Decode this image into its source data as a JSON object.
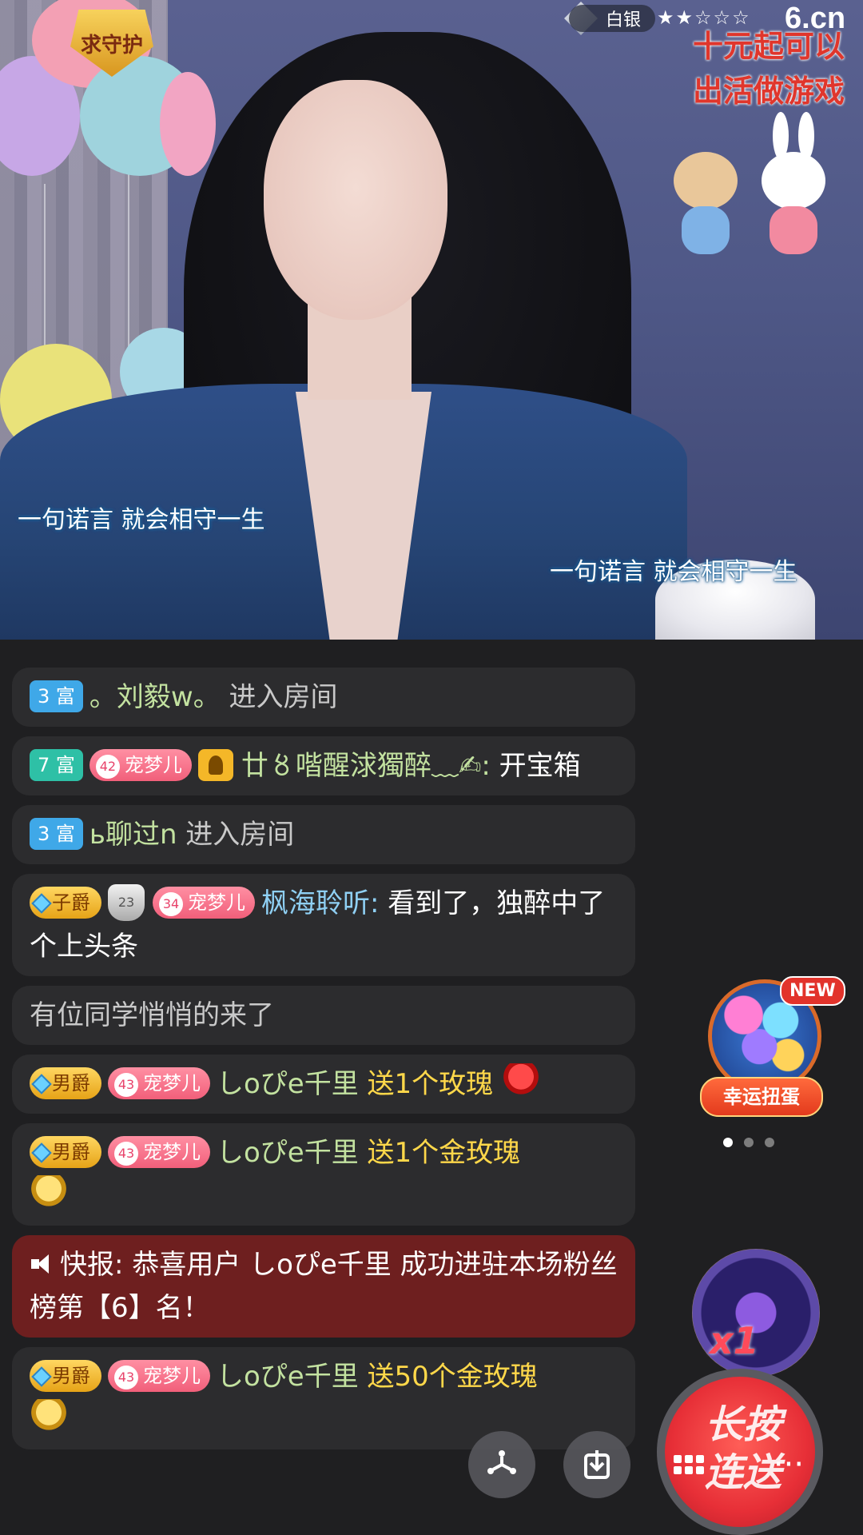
{
  "stream": {
    "guard_badge": "求守护",
    "level_label": "白银",
    "stars": "★★☆☆☆",
    "logo": "6.cn",
    "promo_text": [
      "十元起可以",
      "出活做游戏"
    ],
    "lyric_1": "一句诺言 就会相守一生",
    "lyric_2": "一句诺言 就会相守一生"
  },
  "chat": [
    {
      "type": "enter",
      "rank": "3 富",
      "name": "。刘毅w。",
      "action": " 进入房间"
    },
    {
      "type": "chat",
      "rank": "7 富",
      "fan_level": "42",
      "fan_club": "宠梦儿",
      "name": "廿〥喈醒浗獨醉﹏✍:",
      "text": " 开宝箱"
    },
    {
      "type": "enter",
      "rank": "3 富",
      "name": "ь聊过n",
      "action": " 进入房间"
    },
    {
      "type": "chat",
      "title": "子爵",
      "guard_level": "23",
      "fan_level": "34",
      "fan_club": "宠梦儿",
      "name": "枫海聆听:",
      "text": " 看到了，独醉中了个上头条"
    },
    {
      "type": "system",
      "text": "有位同学悄悄的来了"
    },
    {
      "type": "gift",
      "title": "男爵",
      "fan_level": "43",
      "fan_club": "宠梦儿",
      "name": "しoぴe千里",
      "gift": " 送1个玫瑰"
    },
    {
      "type": "gift",
      "title": "男爵",
      "fan_level": "43",
      "fan_club": "宠梦儿",
      "name": "しoぴe千里",
      "gift": " 送1个金玫瑰"
    },
    {
      "type": "alert",
      "text": "快报: 恭喜用户 しoぴe千里 成功进驻本场粉丝榜第【6】名！"
    },
    {
      "type": "gift",
      "title": "男爵",
      "fan_level": "43",
      "fan_club": "宠梦儿",
      "name": "しoぴe千里",
      "gift": " 送50个金玫瑰"
    }
  ],
  "widgets": {
    "gashapon_label": "幸运扭蛋",
    "gashapon_new": "NEW",
    "orb_multiplier": "x1",
    "press_label": "长按连送",
    "more": "···"
  }
}
